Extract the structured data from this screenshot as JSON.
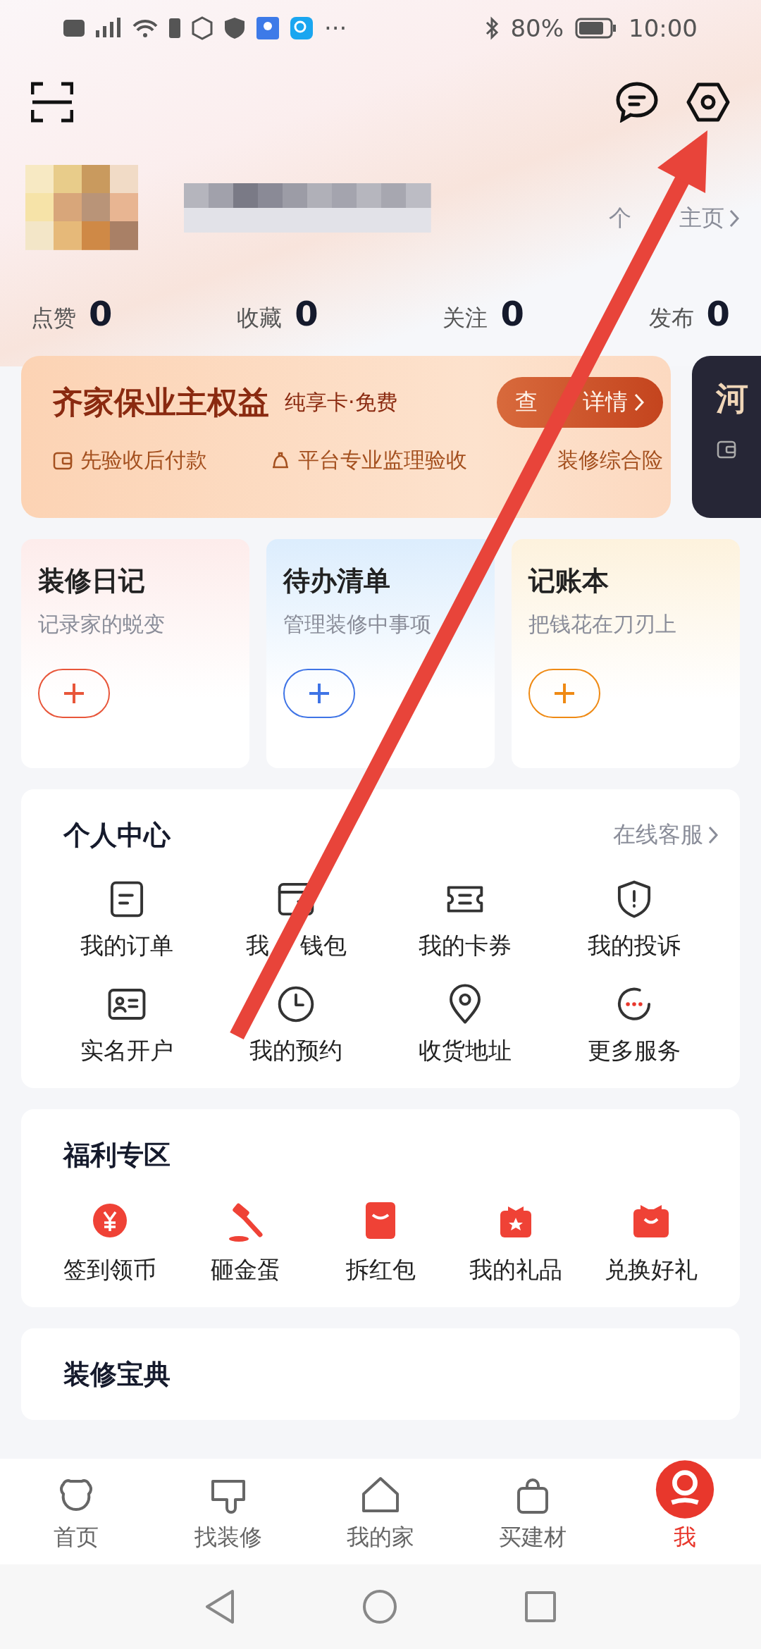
{
  "status_bar": {
    "battery": "80%",
    "time": "10:00",
    "more": "···"
  },
  "profile": {
    "link": [
      "个",
      "主页"
    ]
  },
  "stats": [
    {
      "label": "点赞",
      "value": "0"
    },
    {
      "label": "收藏",
      "value": "0"
    },
    {
      "label": "关注",
      "value": "0"
    },
    {
      "label": "发布",
      "value": "0"
    }
  ],
  "banner": {
    "title": "齐家保业主权益",
    "subtitle": "纯享卡·免费",
    "button": [
      "查",
      "详情"
    ],
    "features": [
      "先验收后付款",
      "平台专业监理验收",
      "装修综合险"
    ]
  },
  "side_card": {
    "title": "河"
  },
  "tools": [
    {
      "title": "装修日记",
      "subtitle": "记录家的蜕变",
      "color": "#e8563a"
    },
    {
      "title": "待办清单",
      "subtitle": "管理装修中事项",
      "color": "#3f74e6"
    },
    {
      "title": "记账本",
      "subtitle": "把钱花在刀刃上",
      "color": "#ef8a14"
    }
  ],
  "personal_center": {
    "title": "个人中心",
    "link": "在线客服",
    "items": [
      {
        "label": "我的订单"
      },
      {
        "label": [
          "我",
          "钱包"
        ]
      },
      {
        "label": "我的卡券"
      },
      {
        "label": "我的投诉"
      },
      {
        "label": "实名开户"
      },
      {
        "label": "我的预约"
      },
      {
        "label": "收货地址"
      },
      {
        "label": "更多服务"
      }
    ]
  },
  "welfare": {
    "title": "福利专区",
    "items": [
      {
        "label": "签到领币"
      },
      {
        "label": "砸金蛋"
      },
      {
        "label": "拆红包"
      },
      {
        "label": "我的礼品"
      },
      {
        "label": "兑换好礼"
      }
    ]
  },
  "guide": {
    "title": "装修宝典"
  },
  "nav": [
    {
      "label": "首页",
      "selected": false
    },
    {
      "label": "找装修",
      "selected": false
    },
    {
      "label": "我的家",
      "selected": false
    },
    {
      "label": "买建材",
      "selected": false
    },
    {
      "label": "我",
      "selected": true
    }
  ]
}
